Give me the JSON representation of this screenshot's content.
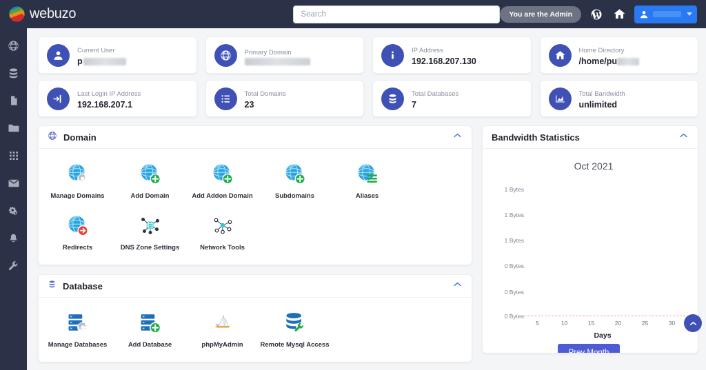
{
  "brand": {
    "name": "webuzo",
    "logo_icon": "webuzo-globe-logo"
  },
  "topbar": {
    "search_placeholder": "Search",
    "admin_badge": "You are the Admin",
    "wordpress_icon": "wordpress-icon",
    "home_icon": "home-icon",
    "user_icon": "user-icon",
    "caret_icon": "chevron-down-icon"
  },
  "sidebar": {
    "items": [
      {
        "icon": "globe-icon",
        "name": "domains"
      },
      {
        "icon": "database-icon",
        "name": "databases"
      },
      {
        "icon": "file-icon",
        "name": "files"
      },
      {
        "icon": "folder-icon",
        "name": "folders"
      },
      {
        "icon": "apps-grid-icon",
        "name": "apps"
      },
      {
        "icon": "mail-icon",
        "name": "email"
      },
      {
        "icon": "gears-icon",
        "name": "settings"
      },
      {
        "icon": "bell-icon",
        "name": "notifications"
      },
      {
        "icon": "wrench-icon",
        "name": "tools"
      }
    ]
  },
  "stats": [
    {
      "label": "Current User",
      "value": "p",
      "redacted": true,
      "redact_width": 62,
      "icon": "user-icon"
    },
    {
      "label": "Primary Domain",
      "value": "",
      "redacted": true,
      "redact_width": 95,
      "icon": "globe-icon"
    },
    {
      "label": "IP Address",
      "value": "192.168.207.130",
      "redacted": false,
      "icon": "info-icon"
    },
    {
      "label": "Home Directory",
      "value": "/home/pu",
      "redacted": true,
      "redact_width": 32,
      "icon": "home-icon"
    },
    {
      "label": "Last Login IP Address",
      "value": "192.168.207.1",
      "redacted": false,
      "icon": "login-icon"
    },
    {
      "label": "Total Domains",
      "value": "23",
      "redacted": false,
      "icon": "list-icon"
    },
    {
      "label": "Total Databases",
      "value": "7",
      "redacted": false,
      "icon": "database-icon"
    },
    {
      "label": "Total Bandwidth",
      "value": "unlimited",
      "redacted": false,
      "icon": "chart-area-icon"
    }
  ],
  "panels": [
    {
      "title": "Domain",
      "header_icon": "globe-icon",
      "collapse_icon": "chevron-up-icon",
      "tiles": [
        {
          "label": "Manage Domains",
          "icon": "globe-gear-icon"
        },
        {
          "label": "Add Domain",
          "icon": "globe-plus-icon"
        },
        {
          "label": "Add Addon Domain",
          "icon": "globe-plus-icon"
        },
        {
          "label": "Subdomains",
          "icon": "globe-plus-icon"
        },
        {
          "label": "Aliases",
          "icon": "globe-lines-icon"
        },
        {
          "label": "Redirects",
          "icon": "globe-redirect-icon"
        },
        {
          "label": "DNS Zone Settings",
          "icon": "dns-network-icon"
        },
        {
          "label": "Network Tools",
          "icon": "network-tools-icon"
        }
      ]
    },
    {
      "title": "Database",
      "header_icon": "database-icon",
      "collapse_icon": "chevron-up-icon",
      "tiles": [
        {
          "label": "Manage Databases",
          "icon": "database-gear-icon"
        },
        {
          "label": "Add Database",
          "icon": "database-plus-icon"
        },
        {
          "label": "phpMyAdmin",
          "icon": "phpmyadmin-icon"
        },
        {
          "label": "Remote Mysql Access",
          "icon": "database-remote-icon"
        }
      ]
    }
  ],
  "bandwidth": {
    "title": "Bandwidth Statistics",
    "collapse_icon": "chevron-up-icon",
    "prev_month_label": "Prev Month"
  },
  "chart_data": {
    "type": "line",
    "title": "Oct 2021",
    "xlabel": "Days",
    "ylabel": "",
    "x": [
      5,
      10,
      15,
      20,
      25,
      30
    ],
    "xticklabels": [
      "5",
      "10",
      "15",
      "20",
      "25",
      "30"
    ],
    "yticklabels": [
      "1 Bytes",
      "1 Bytes",
      "1 Bytes",
      "0 Bytes",
      "0 Bytes",
      "0 Bytes"
    ],
    "series": [
      {
        "name": "Bandwidth",
        "values": [
          0,
          0,
          0,
          0,
          0,
          0
        ],
        "color": "#f2a0a8",
        "style": "dashed"
      }
    ],
    "ylim": [
      0,
      1
    ],
    "xlim": [
      1,
      31
    ],
    "grid": false,
    "legend": false
  },
  "scroll_top": {
    "icon": "chevron-up-icon"
  },
  "colors": {
    "topbar_bg": "#2b3146",
    "sidebar_bg": "#2b3146",
    "page_bg": "#f4f5f7",
    "accent_indigo": "#3f51b5",
    "accent_blue": "#2979f2",
    "button_indigo": "#4e5bd4",
    "chart_red": "#f2a0a8"
  }
}
